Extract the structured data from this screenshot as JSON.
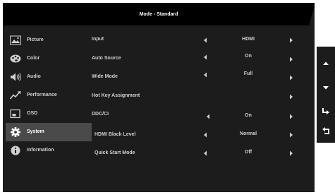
{
  "header": {
    "title": "Mode - Standard"
  },
  "sidebar": {
    "items": [
      {
        "label": "Picture",
        "icon": "picture-icon",
        "selected": false
      },
      {
        "label": "Color",
        "icon": "palette-icon",
        "selected": false
      },
      {
        "label": "Audio",
        "icon": "speaker-icon",
        "selected": false
      },
      {
        "label": "Performance",
        "icon": "performance-graph-icon",
        "selected": false
      },
      {
        "label": "OSD",
        "icon": "osd-window-icon",
        "selected": false
      },
      {
        "label": "System",
        "icon": "gear-icon",
        "selected": true
      },
      {
        "label": "Information",
        "icon": "info-icon",
        "selected": false
      }
    ]
  },
  "settings": {
    "rows": [
      {
        "name": "Input",
        "value": "HDMI",
        "has_left_arrow": true,
        "has_right_arrow": true
      },
      {
        "name": "Auto Source",
        "value": "On",
        "has_left_arrow": true,
        "has_right_arrow": true
      },
      {
        "name": "Wide Mode",
        "value": "Full",
        "has_left_arrow": true,
        "has_right_arrow": true
      },
      {
        "name": "Hot Key Assignment",
        "value": "",
        "has_left_arrow": false,
        "has_right_arrow": true
      },
      {
        "name": "DDC/CI",
        "value": "On",
        "has_left_arrow": true,
        "has_right_arrow": true
      },
      {
        "name": "HDMI Black Level",
        "value": "Normal",
        "has_left_arrow": true,
        "has_right_arrow": true
      },
      {
        "name": "Quick Start Mode",
        "value": "Off",
        "has_left_arrow": true,
        "has_right_arrow": true
      }
    ]
  },
  "nav_keys": [
    {
      "name": "up-icon"
    },
    {
      "name": "down-icon"
    },
    {
      "name": "enter-icon"
    },
    {
      "name": "return-icon"
    }
  ],
  "colors": {
    "panel_bg": "#1c1c1c",
    "header_bg": "#000000",
    "selected_bg": "#4a4a4a",
    "text": "#cfcfcf",
    "text_bright": "#ffffff"
  }
}
